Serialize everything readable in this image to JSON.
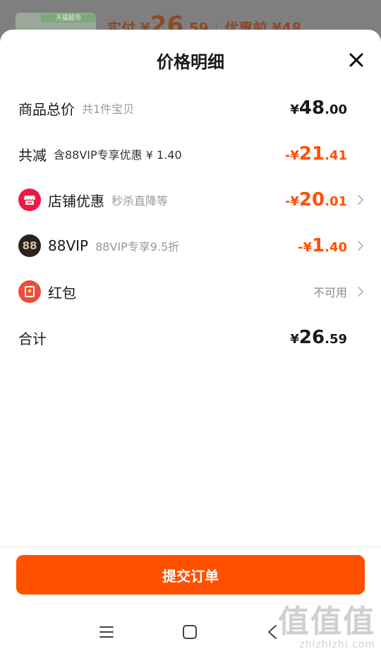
{
  "background": {
    "thumb_tag": "天猫超市",
    "price_prefix": "实付 ¥",
    "price_int": "26",
    "price_dec": ".59",
    "orig_label": "优惠前 ¥48"
  },
  "sheet": {
    "title": "价格明细",
    "rows": {
      "goods_total": {
        "label": "商品总价",
        "sub": "共1件宝贝",
        "currency": "¥",
        "int": "48",
        "dec": ".00"
      },
      "total_discount": {
        "label": "共减",
        "sub": "含88VIP专享优惠 ¥ 1.40",
        "currency": "-¥",
        "int": "21",
        "dec": ".41"
      },
      "store_discount": {
        "label": "店铺优惠",
        "sub": "秒杀直降等",
        "currency": "-¥",
        "int": "20",
        "dec": ".01"
      },
      "vip": {
        "icon_text": "88",
        "label": "88VIP",
        "sub": "88VIP专享9.5折",
        "currency": "-¥",
        "int": "1",
        "dec": ".40"
      },
      "red_packet": {
        "label": "红包",
        "status": "不可用"
      },
      "total": {
        "label": "合计",
        "currency": "¥",
        "int": "26",
        "dec": ".59"
      }
    },
    "submit_label": "提交订单"
  },
  "watermark": {
    "big": "值值值",
    "small": "zhizhizhi.com"
  },
  "colors": {
    "accent": "#ff5000",
    "store_icon": "#ee1845",
    "vip_icon": "#2a2321",
    "red_packet_icon": "#f04a3a"
  },
  "icons": [
    "close-icon",
    "store-icon",
    "vip-88-icon",
    "red-packet-icon",
    "chevron-right-icon",
    "menu-icon",
    "home-icon",
    "back-icon"
  ]
}
